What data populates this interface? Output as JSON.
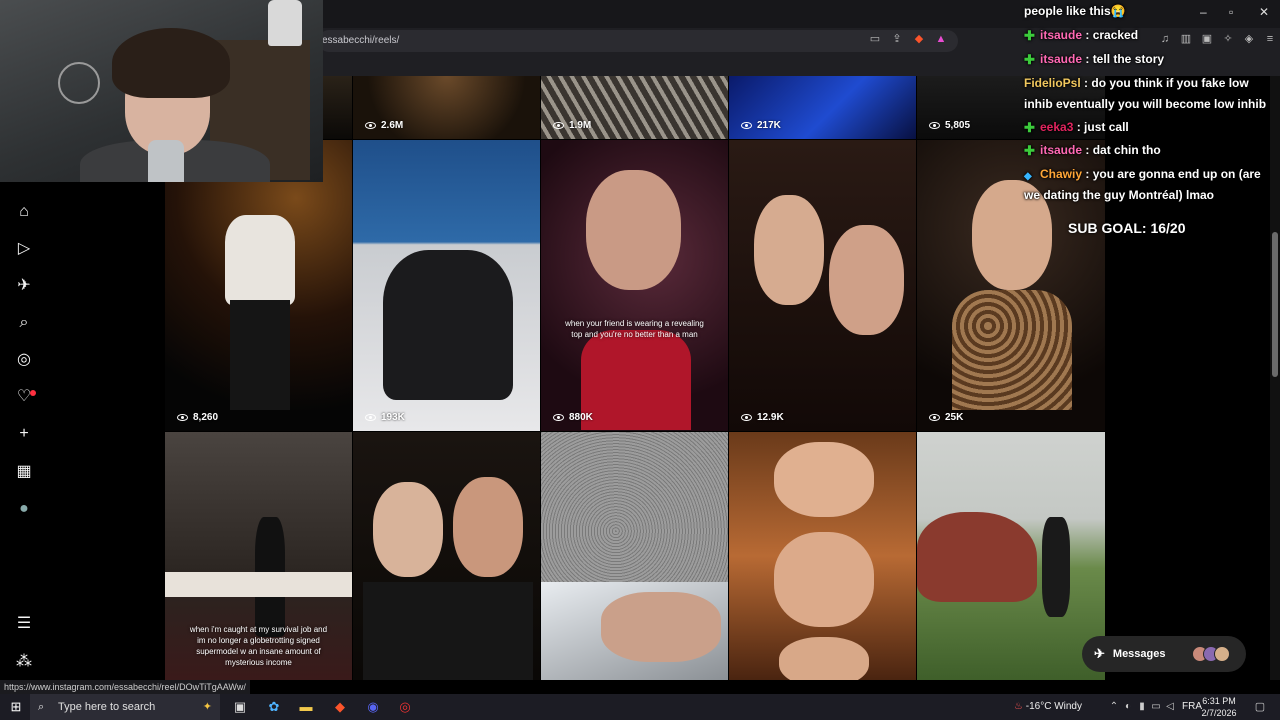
{
  "browser": {
    "url": "essabecchi/reels/",
    "status_link": "https://www.instagram.com/essabecchi/reel/DOwTiTgAAWw/"
  },
  "sidebar": {
    "items": [
      {
        "icon": "home-icon",
        "glyph": "⌂"
      },
      {
        "icon": "reels-icon",
        "glyph": "▷"
      },
      {
        "icon": "direct-icon",
        "glyph": "✈"
      },
      {
        "icon": "search-icon",
        "glyph": "⌕"
      },
      {
        "icon": "explore-icon",
        "glyph": "◎"
      },
      {
        "icon": "notifications-icon",
        "glyph": "♡"
      },
      {
        "icon": "create-icon",
        "glyph": "+"
      },
      {
        "icon": "dashboard-icon",
        "glyph": "▦"
      },
      {
        "icon": "profile-icon",
        "glyph": "●"
      },
      {
        "icon": "more-icon",
        "glyph": "☰"
      },
      {
        "icon": "also-from-meta-icon",
        "glyph": "⁂"
      }
    ]
  },
  "reels": [
    {
      "views": "2.6M"
    },
    {
      "views": "1.9M"
    },
    {
      "views": "217K"
    },
    {
      "views": "5,805"
    },
    {
      "views": "8,260"
    },
    {
      "views": "193K"
    },
    {
      "views": "880K",
      "caption": "when your friend is wearing a revealing top and you're no better than a man"
    },
    {
      "views": "12.9K"
    },
    {
      "views": "25K"
    },
    {
      "caption": "when i'm caught at my survival job and im no longer a globetrotting signed supermodel w an insane amount of mysterious income"
    },
    {},
    {},
    {},
    {}
  ],
  "chat": {
    "messages": [
      {
        "user": "",
        "text": "people like this😭"
      },
      {
        "user": "itsaude",
        "user_color": "#ff69b4",
        "text": "cracked"
      },
      {
        "user": "itsaude",
        "user_color": "#ff69b4",
        "text": "tell the story"
      },
      {
        "user": "FidelioPsl",
        "user_color": "#f0c75e",
        "text": "do you think if you fake low inhib eventually you will become low inhib"
      },
      {
        "user": "eeka3",
        "user_color": "#e0245e",
        "text": "just call"
      },
      {
        "user": "itsaude",
        "user_color": "#ff69b4",
        "text": "dat chin tho"
      },
      {
        "user": "Chawiy",
        "user_color": "#ffa637",
        "text": "you are gonna end up on (are we dating the guy Montréal) lmao"
      }
    ],
    "sub_goal": "SUB GOAL: 16/20"
  },
  "messages_button": {
    "label": "Messages"
  },
  "taskbar": {
    "search_placeholder": "Type here to search",
    "weather": "-16°C  Windy",
    "language": "FRA",
    "time": "6:31 PM",
    "date": "2/7/2026"
  },
  "colors": {
    "accent": "#ff3040",
    "brave": "#fb542b"
  }
}
